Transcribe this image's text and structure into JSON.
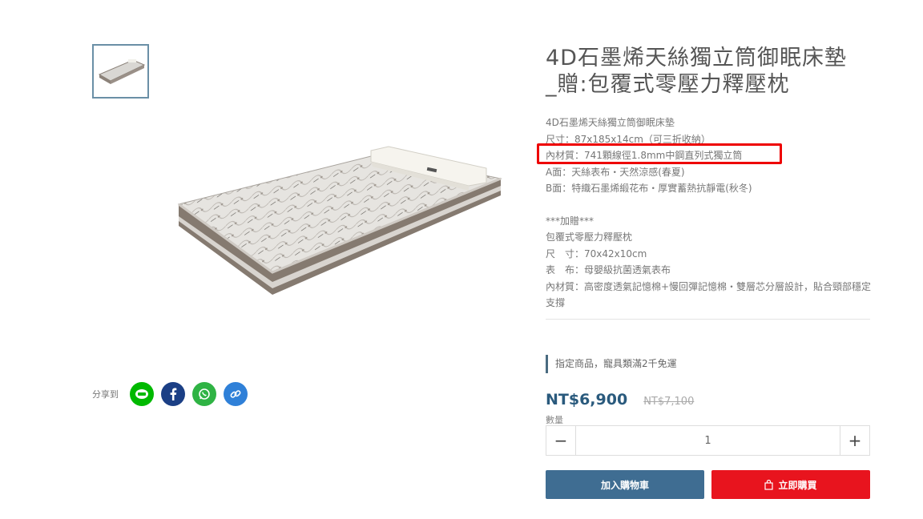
{
  "product": {
    "title_line1": "4D石墨烯天絲獨立筒御眠床墊",
    "title_line2": "_贈:包覆式零壓力釋壓枕",
    "description": [
      "4D石墨烯天絲獨立筒御眠床墊",
      "尺寸：87x185x14cm（可三折收納）",
      "內材質：741顆線徑1.8mm中鋼直列式獨立筒",
      "A面：天絲表布・天然涼感(春夏)",
      "B面：特織石墨烯緞花布・厚實蓄熱抗靜電(秋冬)"
    ],
    "gift_header": "***加贈***",
    "gift_lines": [
      "包覆式零壓力釋壓枕",
      "尺　寸：70x42x10cm",
      "表　布：母嬰級抗菌透氣表布"
    ],
    "gift_material": "內材質：高密度透氣記憶棉+慢回彈記憶棉・雙層芯分層設計，貼合頸部穩定支撐"
  },
  "share": {
    "label": "分享到",
    "icons": [
      "line-icon",
      "facebook-icon",
      "whatsapp-icon",
      "copy-link-icon"
    ]
  },
  "promo": {
    "text": "指定商品，寵具類滿2千免運"
  },
  "price": {
    "current": "NT$6,900",
    "original": "NT$7,100"
  },
  "quantity": {
    "label": "數量",
    "value": "1",
    "minus": "−",
    "plus": "+"
  },
  "actions": {
    "add_to_cart": "加入購物車",
    "buy_now": "立即購買"
  },
  "colors": {
    "price": "#2a5a7d",
    "cart_button": "#3f6d92",
    "buy_button": "#e8141e",
    "highlight": "#ee0000",
    "line": "#00b900",
    "facebook": "#1b3f85",
    "whatsapp": "#2fb344",
    "link": "#2f80d8"
  }
}
